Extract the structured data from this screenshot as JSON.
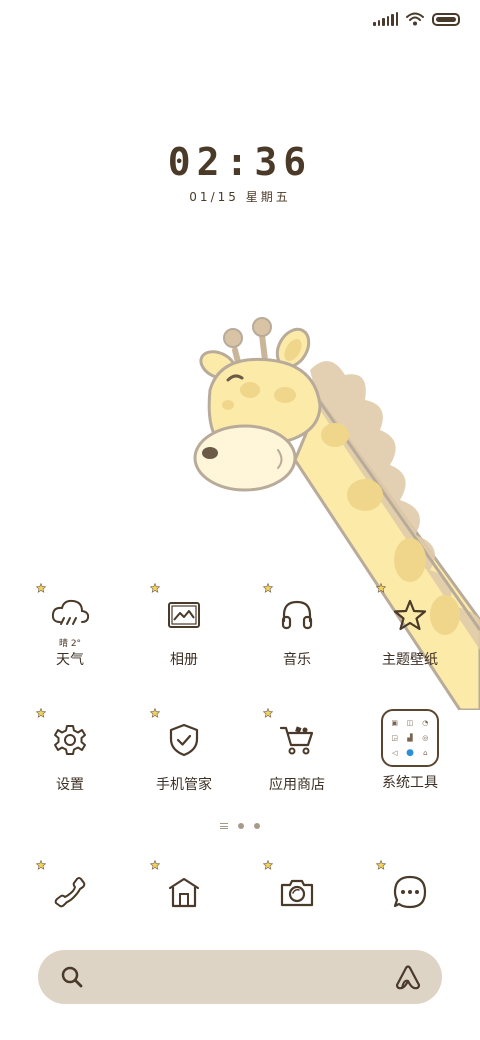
{
  "status_bar": {
    "signal_icon": "signal-bars-icon",
    "wifi_icon": "wifi-icon",
    "battery_icon": "battery-icon"
  },
  "clock": {
    "time": "02:36",
    "date": "01/15 星期五"
  },
  "apps": [
    {
      "label": "天气",
      "icon": "weather-cloud-rain-icon",
      "sub": "晴 2°"
    },
    {
      "label": "相册",
      "icon": "gallery-icon"
    },
    {
      "label": "音乐",
      "icon": "headphones-icon"
    },
    {
      "label": "主题壁纸",
      "icon": "star-icon"
    },
    {
      "label": "设置",
      "icon": "gear-icon"
    },
    {
      "label": "手机管家",
      "icon": "shield-check-icon"
    },
    {
      "label": "应用商店",
      "icon": "shopping-cart-icon"
    },
    {
      "label": "系统工具",
      "icon": "toolbox-folder-icon"
    }
  ],
  "dock": [
    {
      "icon": "phone-icon"
    },
    {
      "icon": "home-icon"
    },
    {
      "icon": "camera-icon"
    },
    {
      "icon": "message-bubble-icon"
    }
  ],
  "search": {
    "icon": "search-icon",
    "assistant_icon": "assistant-icon"
  },
  "colors": {
    "background": "#ffffff",
    "text": "#4a3a2a",
    "search_bar": "#ddd4c6",
    "accent_star": "#f3d35b",
    "giraffe_body": "#fbeaa8",
    "giraffe_spots": "#f0d68a",
    "giraffe_mane": "#e0cbaa"
  }
}
